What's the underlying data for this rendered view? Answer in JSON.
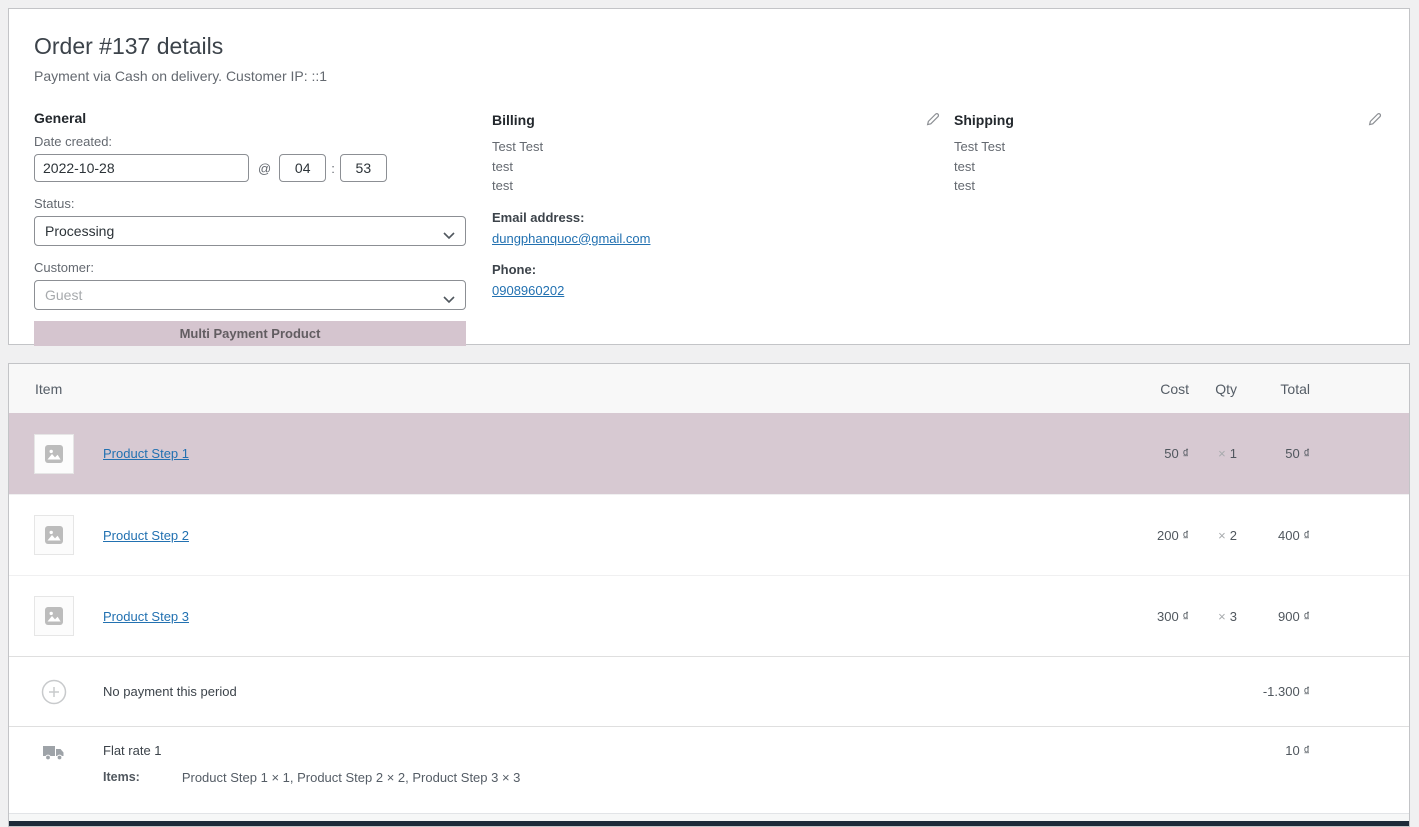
{
  "order": {
    "title": "Order #137 details",
    "subtitle": "Payment via Cash on delivery. Customer IP: ::1"
  },
  "general": {
    "heading": "General",
    "date_label": "Date created:",
    "date_value": "2022-10-28",
    "at_symbol": "@",
    "hour_value": "04",
    "time_separator": ":",
    "minute_value": "53",
    "status_label": "Status:",
    "status_value": "Processing",
    "customer_label": "Customer:",
    "customer_placeholder": "Guest",
    "multi_payment_button_label": "Multi Payment Product"
  },
  "billing": {
    "heading": "Billing",
    "address_lines": [
      "Test Test",
      "test",
      "test"
    ],
    "email_label": "Email address:",
    "email_value": "dungphanquoc@gmail.com",
    "phone_label": "Phone:",
    "phone_value": "0908960202"
  },
  "shipping": {
    "heading": "Shipping",
    "address_lines": [
      "Test Test",
      "test",
      "test"
    ]
  },
  "items_table": {
    "columns": {
      "item": "Item",
      "cost": "Cost",
      "qty": "Qty",
      "total": "Total"
    },
    "times_symbol": "×",
    "products": [
      {
        "name": "Product Step 1",
        "cost": "50 ₫",
        "qty": "1",
        "total": "50 ₫"
      },
      {
        "name": "Product Step 2",
        "cost": "200 ₫",
        "qty": "2",
        "total": "400 ₫"
      },
      {
        "name": "Product Step 3",
        "cost": "300 ₫",
        "qty": "3",
        "total": "900 ₫"
      }
    ],
    "fee_row": {
      "label": "No payment this period",
      "total": "-1.300 ₫"
    },
    "shipping_row": {
      "label": "Flat rate 1",
      "items_label": "Items:",
      "items_value": "Product Step 1 × 1, Product Step 2 × 2, Product Step 3 × 3",
      "total": "10 ₫"
    }
  },
  "colors": {
    "highlight_row": "#d7c9d2",
    "accent_button": "#d5c5cf",
    "link_blue": "#2271b1",
    "page_background": "#f0f0f1"
  }
}
